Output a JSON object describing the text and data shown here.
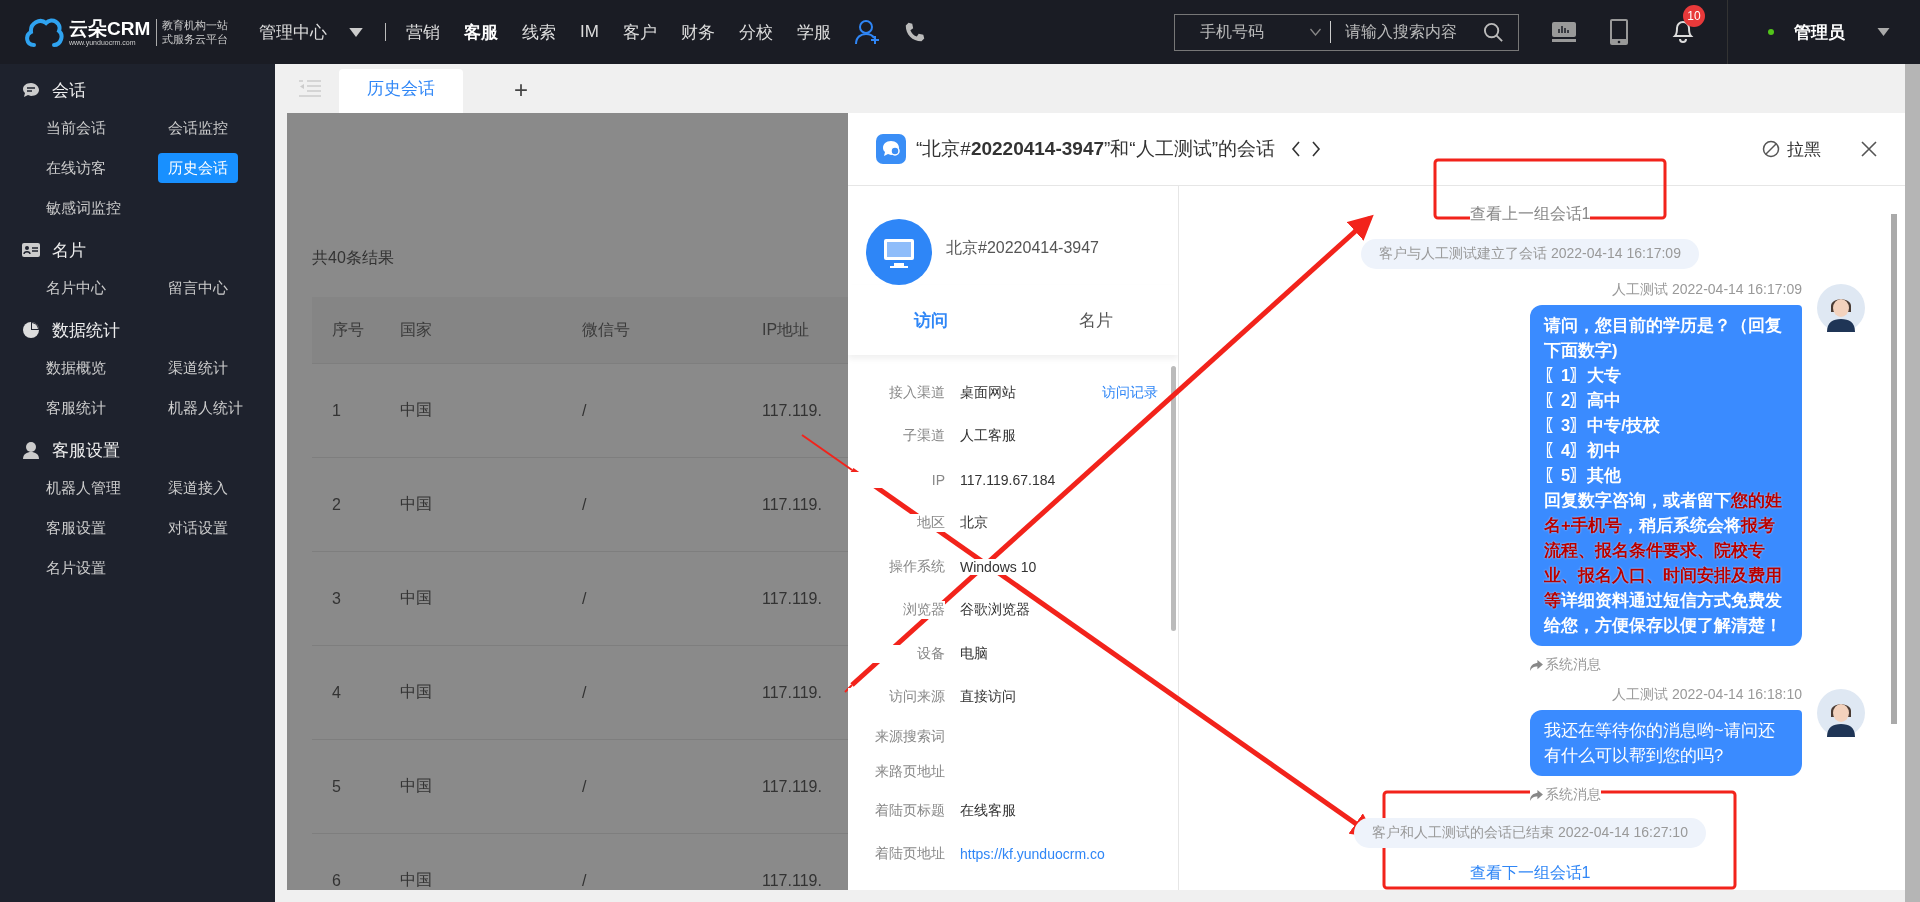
{
  "header": {
    "logo": {
      "name": "云朵CRM",
      "url": "www.yunduocrm.com",
      "slogan": [
        "教育机构一站",
        "式服务云平台"
      ]
    },
    "module_menu": "管理中心",
    "nav": [
      {
        "label": "营销",
        "selected": false
      },
      {
        "label": "客服",
        "selected": true
      },
      {
        "label": "线索",
        "selected": false
      },
      {
        "label": "IM",
        "selected": false
      },
      {
        "label": "客户",
        "selected": false
      },
      {
        "label": "财务",
        "selected": false
      },
      {
        "label": "分校",
        "selected": false
      },
      {
        "label": "学服",
        "selected": false
      }
    ],
    "search": {
      "type": "手机号码",
      "placeholder": "请输入搜索内容"
    },
    "notifications": "10",
    "user": {
      "name": "管理员",
      "online": true
    }
  },
  "sidebar": [
    {
      "kind": "chat",
      "title": "会话",
      "items": [
        {
          "label": "当前会话",
          "selected": false
        },
        {
          "label": "会话监控",
          "selected": false
        },
        {
          "label": "在线访客",
          "selected": false
        },
        {
          "label": "历史会话",
          "selected": true
        },
        {
          "label": "敏感词监控",
          "selected": false
        }
      ]
    },
    {
      "kind": "card",
      "title": "名片",
      "items": [
        {
          "label": "名片中心",
          "selected": false
        },
        {
          "label": "留言中心",
          "selected": false
        }
      ]
    },
    {
      "kind": "chart",
      "title": "数据统计",
      "items": [
        {
          "label": "数据概览",
          "selected": false
        },
        {
          "label": "渠道统计",
          "selected": false
        },
        {
          "label": "客服统计",
          "selected": false
        },
        {
          "label": "机器人统计",
          "selected": false
        }
      ]
    },
    {
      "kind": "agent",
      "title": "客服设置",
      "items": [
        {
          "label": "机器人管理",
          "selected": false
        },
        {
          "label": "渠道接入",
          "selected": false
        },
        {
          "label": "客服设置",
          "selected": false
        },
        {
          "label": "对话设置",
          "selected": false
        },
        {
          "label": "名片设置",
          "selected": false
        }
      ]
    }
  ],
  "tabs": [
    {
      "label": "历史会话",
      "selected": true
    }
  ],
  "add_tab": "+",
  "result_count": "共40条结果",
  "table": {
    "columns": [
      "序号",
      "国家",
      "微信号",
      "IP地址"
    ],
    "rows": [
      [
        "1",
        "中国",
        "/",
        "117.119."
      ],
      [
        "2",
        "中国",
        "/",
        "117.119."
      ],
      [
        "3",
        "中国",
        "/",
        "117.119."
      ],
      [
        "4",
        "中国",
        "/",
        "117.119."
      ],
      [
        "5",
        "中国",
        "/",
        "117.119."
      ],
      [
        "6",
        "中国",
        "/",
        "117.119."
      ]
    ]
  },
  "drawer": {
    "title": "“北京#**20220414-3947**”和“人工测试”的会话",
    "blacklist": "拉黑",
    "visitor": {
      "name": "北京#20220414-3947"
    },
    "tabs": [
      {
        "label": "访问",
        "selected": true
      },
      {
        "label": "名片",
        "selected": false
      }
    ],
    "info": [
      {
        "label": "接入渠道",
        "value": "桌面网站",
        "kind": "text",
        "action": "访问记录"
      },
      {
        "label": "子渠道",
        "value": "人工客服",
        "kind": "text"
      },
      {
        "label": "IP",
        "value": "117.119.67.184",
        "kind": "text"
      },
      {
        "label": "地区",
        "value": "北京",
        "kind": "text"
      },
      {
        "label": "操作系统",
        "value": "Windows 10",
        "kind": "text"
      },
      {
        "label": "浏览器",
        "value": "谷歌浏览器",
        "kind": "text"
      },
      {
        "label": "设备",
        "value": "电脑",
        "kind": "text"
      },
      {
        "label": "访问来源",
        "value": "直接访问",
        "kind": "text"
      },
      {
        "label": "来源搜索词",
        "kind": "empty"
      },
      {
        "label": "来路页地址",
        "kind": "empty"
      },
      {
        "label": "着陆页标题",
        "value": "在线客服",
        "kind": "text"
      },
      {
        "label": "着陆页地址",
        "value": "https://kf.yunduocrm.co",
        "kind": "url"
      }
    ],
    "chat": {
      "prev_link": "查看上一组会话1",
      "next_link": "查看下一组会话1",
      "messages": [
        {
          "kind": "system",
          "text": "客户与人工测试建立了会话 2022-04-14 16:17:09"
        },
        {
          "kind": "agent",
          "meta": "人工测试 2022-04-14 16:17:09",
          "bold": true,
          "note": "系统消息",
          "paragraphs": [
            {
              "segments": [
                {
                  "text": "请问，您目前的学历是？（回复下面数字)",
                  "highlight": false
                }
              ]
            },
            {
              "segments": [
                {
                  "text": "〖1〗大专",
                  "highlight": false
                }
              ]
            },
            {
              "segments": [
                {
                  "text": "〖2〗高中",
                  "highlight": false
                }
              ]
            },
            {
              "segments": [
                {
                  "text": "〖3〗中专/技校",
                  "highlight": false
                }
              ]
            },
            {
              "segments": [
                {
                  "text": "〖4〗初中",
                  "highlight": false
                }
              ]
            },
            {
              "segments": [
                {
                  "text": "〖5〗其他",
                  "highlight": false
                }
              ]
            },
            {
              "segments": [
                {
                  "text": "回复数字咨询，或者留下",
                  "highlight": false
                },
                {
                  "text": "您的姓名+手机号",
                  "highlight": true
                },
                {
                  "text": "，稍后系统会将",
                  "highlight": false
                },
                {
                  "text": "报考流程、报名条件要求、院校专业、报名入口、时间安排及费用等",
                  "highlight": true
                },
                {
                  "text": "详细资料通过短信方式免费发给您，方便保存以便了解清楚！",
                  "highlight": false
                }
              ]
            }
          ]
        },
        {
          "kind": "agent",
          "meta": "人工测试 2022-04-14 16:18:10",
          "bold": false,
          "note": "系统消息",
          "paragraphs": [
            {
              "segments": [
                {
                  "text": "我还在等待你的消息哟~请问还有什么可以帮到您的吗?",
                  "highlight": false
                }
              ]
            }
          ]
        },
        {
          "kind": "system",
          "text": "客户和人工测试的会话已结束 2022-04-14 16:27:10"
        }
      ]
    }
  }
}
